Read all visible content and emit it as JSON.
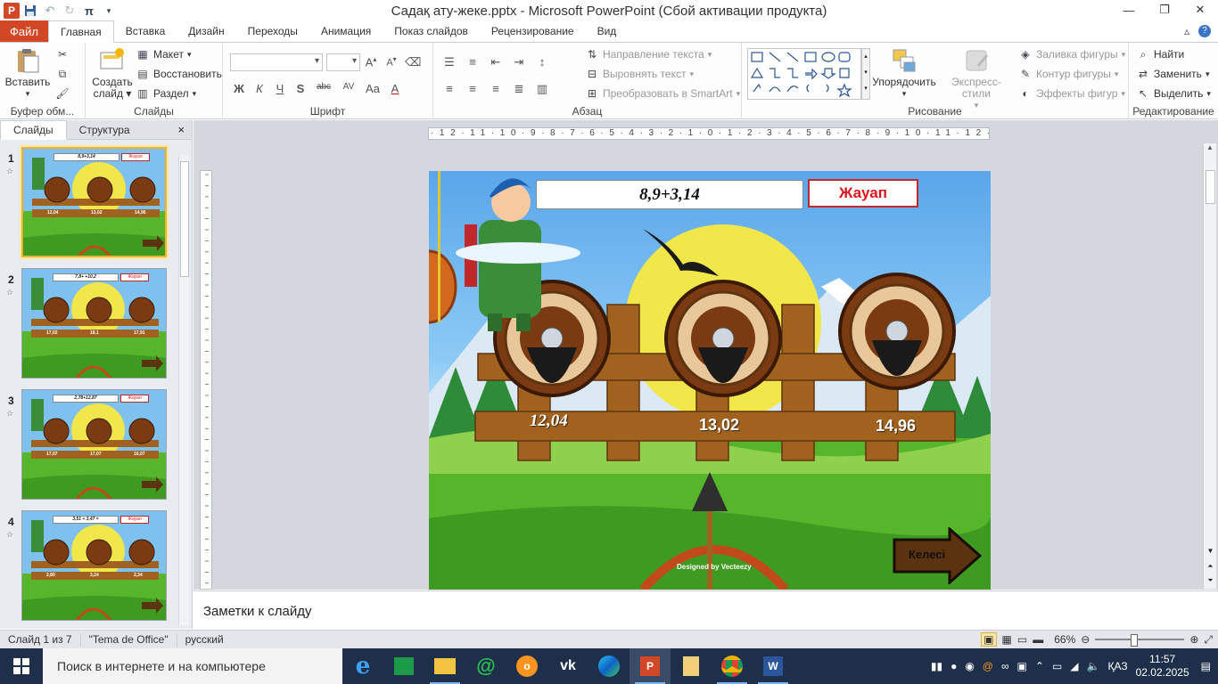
{
  "window": {
    "title": "Садақ ату-жеке.pptx - Microsoft PowerPoint (Сбой активации продукта)",
    "app_icon": "P"
  },
  "ribbon_tabs": {
    "file": "Файл",
    "tabs": [
      "Главная",
      "Вставка",
      "Дизайн",
      "Переходы",
      "Анимация",
      "Показ слайдов",
      "Рецензирование",
      "Вид"
    ]
  },
  "ribbon": {
    "clipboard": {
      "paste": "Вставить",
      "label": "Буфер обм..."
    },
    "slides": {
      "new_slide_line1": "Создать",
      "new_slide_line2": "слайд",
      "layout": "Макет",
      "reset": "Восстановить",
      "section": "Раздел",
      "label": "Слайды"
    },
    "font": {
      "label": "Шрифт"
    },
    "paragraph": {
      "text_direction": "Направление текста",
      "align_text": "Выровнять текст",
      "smartart": "Преобразовать в SmartArt",
      "label": "Абзац"
    },
    "drawing": {
      "arrange": "Упорядочить",
      "quick_styles": "Экспресс-стили",
      "shape_fill": "Заливка фигуры",
      "shape_outline": "Контур фигуры",
      "shape_effects": "Эффекты фигур",
      "label": "Рисование"
    },
    "editing": {
      "find": "Найти",
      "replace": "Заменить",
      "select": "Выделить",
      "label": "Редактирование"
    }
  },
  "left_pane": {
    "tab_slides": "Слайды",
    "tab_outline": "Структура",
    "close": "×",
    "thumbnails": [
      {
        "num": "1",
        "question": "8,9+3,14",
        "a": "12,04",
        "b": "13,02",
        "c": "14,96"
      },
      {
        "num": "2",
        "question": "7,8+ +10,2",
        "a": "17,02",
        "b": "18,1",
        "c": "17,91"
      },
      {
        "num": "3",
        "question": "2,78+12,87",
        "a": "17,07",
        "b": "17,07",
        "c": "16,07"
      },
      {
        "num": "4",
        "question": "3,51 + 3,47 =",
        "a": "2,80",
        "b": "3,24",
        "c": "2,34"
      }
    ],
    "thumb_answer": "Жауап"
  },
  "ruler": {
    "h_ticks": "·12·11·10·9·8·7·6·5·4·3·2·1·0·1·2·3·4·5·6·7·8·9·10·11·12·"
  },
  "slide": {
    "question": "8,9+3,14",
    "answer_button": "Жауап",
    "answers": [
      "12,04",
      "13,02",
      "14,96"
    ],
    "next_button": "Келесі",
    "watermark": "Designed by Vecteezy",
    "colors": {
      "answer_red": "#e1141b",
      "fence": "#a0621e",
      "grass": "#56b52a"
    }
  },
  "notes": {
    "placeholder": "Заметки к слайду"
  },
  "status": {
    "slide_count": "Слайд 1 из 7",
    "theme": "\"Tema de Office\"",
    "language": "русский",
    "zoom": "66%"
  },
  "taskbar": {
    "search_placeholder": "Поиск в интернете и на компьютере",
    "lang": "ҚАЗ",
    "time": "11:57",
    "date": "02.02.2025"
  }
}
